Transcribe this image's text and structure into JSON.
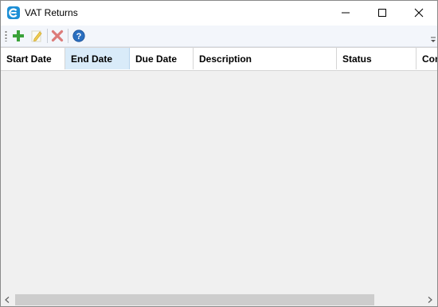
{
  "window": {
    "title": "VAT Returns",
    "app_icon": "app-logo-e-icon",
    "controls": [
      "minimize-icon",
      "maximize-icon",
      "close-icon"
    ]
  },
  "toolbar": {
    "buttons": [
      {
        "icon": "add-icon",
        "color": "#3aa23a"
      },
      {
        "icon": "edit-icon",
        "color": "#e8c03a",
        "disabled": true
      },
      {
        "icon": "delete-icon",
        "color": "#d9534f",
        "disabled": true
      },
      {
        "icon": "help-icon",
        "color": "#2a6fc0"
      }
    ]
  },
  "grid": {
    "columns": [
      "Start Date",
      "End Date",
      "Due Date",
      "Description",
      "Status",
      "Com"
    ],
    "selected_column": "End Date",
    "rows": []
  },
  "colors": {
    "accent": "#1d8fd6",
    "selected_header": "#d9ebf9",
    "toolbar_bg": "#f3f6fb",
    "grid_bg": "#f0f0f0"
  }
}
